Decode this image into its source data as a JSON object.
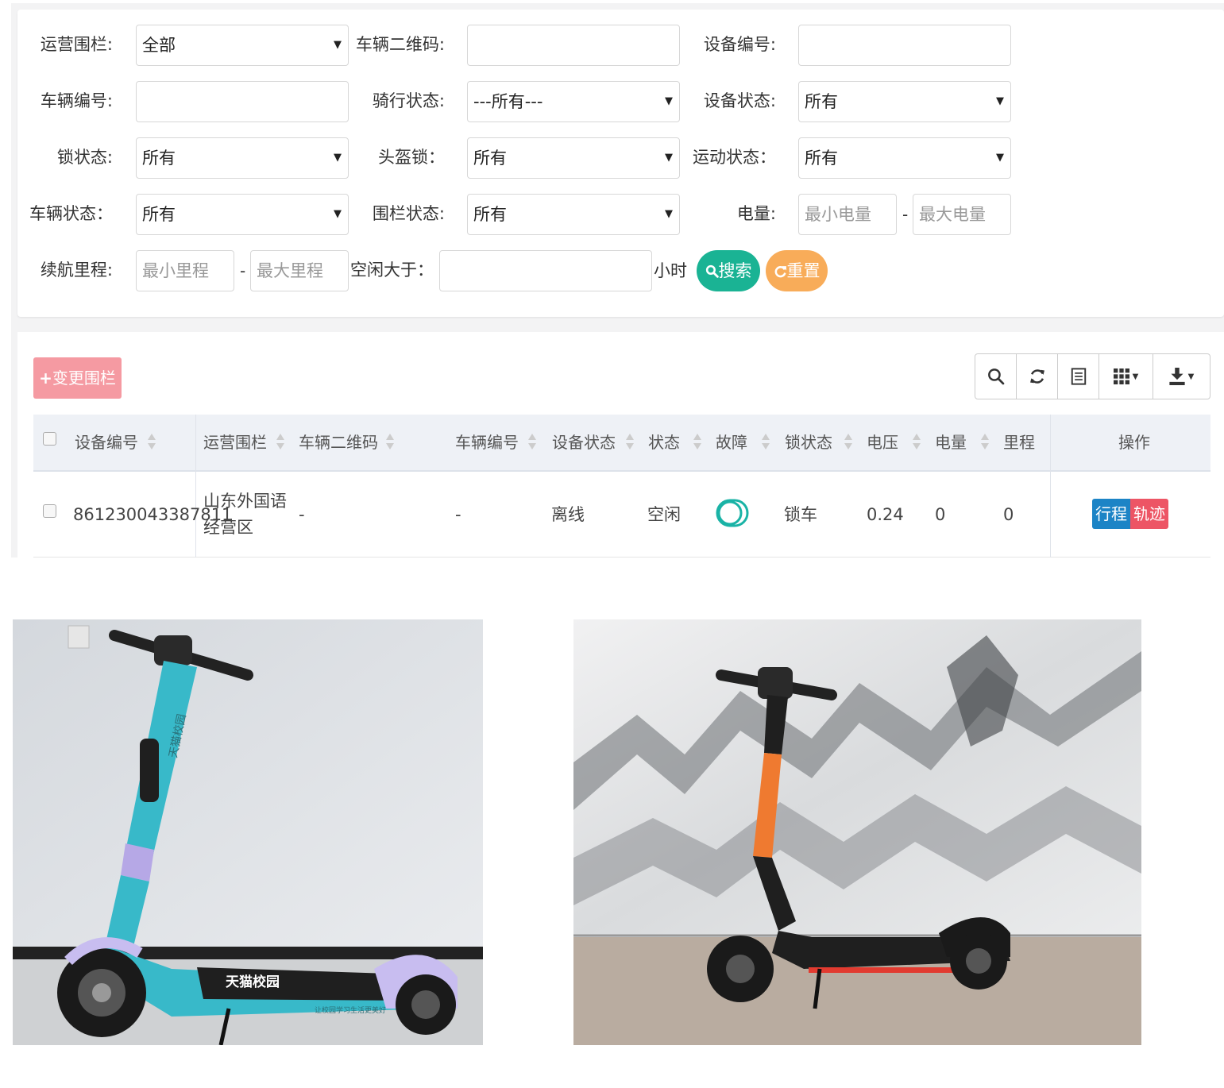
{
  "filters": {
    "fence_label": "运营围栏:",
    "fence_value": "全部",
    "qrcode_label": "车辆二维码:",
    "qrcode_value": "",
    "device_no_label": "设备编号:",
    "device_no_value": "",
    "vehicle_no_label": "车辆编号:",
    "vehicle_no_value": "",
    "ride_status_label": "骑行状态:",
    "ride_status_value": "---所有---",
    "device_status_label": "设备状态:",
    "device_status_value": "所有",
    "lock_status_label": "锁状态:",
    "lock_status_value": "所有",
    "helmet_lock_label": "头盔锁：",
    "helmet_lock_value": "所有",
    "motion_status_label": "运动状态：",
    "motion_status_value": "所有",
    "vehicle_status_label": "车辆状态：",
    "vehicle_status_value": "所有",
    "fence_status_label": "围栏状态:",
    "fence_status_value": "所有",
    "battery_label": "电量:",
    "battery_min_placeholder": "最小电量",
    "battery_max_placeholder": "最大电量",
    "range_label": "续航里程:",
    "range_min_placeholder": "最小里程",
    "range_max_placeholder": "最大里程",
    "idle_label": "空闲大于：",
    "idle_value": "",
    "idle_unit": "小时",
    "separator": "-",
    "search_label": "搜索",
    "reset_label": "重置"
  },
  "table": {
    "change_fence_label": "变更围栏",
    "columns": [
      "设备编号",
      "运营围栏",
      "车辆二维码",
      "车辆编号",
      "设备状态",
      "状态",
      "故障",
      "锁状态",
      "电压",
      "电量",
      "里程",
      "操作"
    ],
    "rows": [
      {
        "device_no": "861230043387811",
        "fence_line1": "山东外国语",
        "fence_line2": "经营区",
        "qrcode": "-",
        "vehicle_no": "-",
        "device_status": "离线",
        "status": "空闲",
        "fault": "",
        "lock_status": "锁车",
        "voltage": "0.24",
        "battery": "0",
        "mileage": "0",
        "action_trip": "行程",
        "action_track": "轨迹"
      }
    ]
  },
  "photos": {
    "left_deck_brand": "天猫校园",
    "left_deck_slogan": "让校园学习生活更美好"
  },
  "colors": {
    "search": "#1ab394",
    "reset": "#f8ac59",
    "change_fence": "#f59aa2",
    "trip_button": "#1c84c6",
    "track_button": "#ed5565",
    "toggle": "#1ab3a6"
  },
  "icons": {
    "toolbar": [
      "search-icon",
      "refresh-icon",
      "list-icon",
      "columns-grid-icon",
      "download-icon"
    ],
    "buttons": [
      "plus-icon",
      "search-icon",
      "refresh-icon"
    ]
  }
}
